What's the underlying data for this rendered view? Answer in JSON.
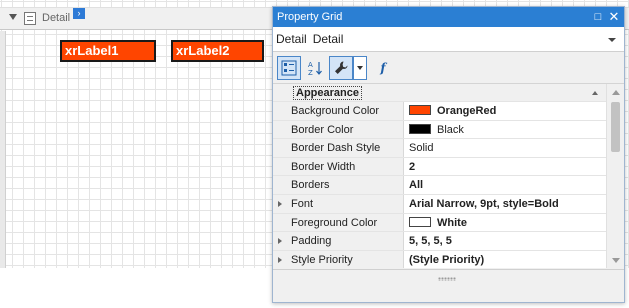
{
  "designer": {
    "band_label": "Detail",
    "labels": [
      "xrLabel1",
      "xrLabel2"
    ]
  },
  "property_grid": {
    "title": "Property Grid",
    "selected_object": {
      "name": "Detail",
      "type": "Detail"
    },
    "toolbar": {
      "categorized_icon": "categorized-icon",
      "alphabetical_icon": "sort-az-icon",
      "properties_icon": "wrench-icon",
      "events_icon": "function-icon",
      "events_glyph": "f"
    },
    "category": "Appearance",
    "rows": [
      {
        "name": "Background Color",
        "value": "OrangeRed",
        "swatch": "#ff4500",
        "bold": true,
        "expandable": false
      },
      {
        "name": "Border Color",
        "value": "Black",
        "swatch": "#000000",
        "bold": false,
        "expandable": false
      },
      {
        "name": "Border Dash Style",
        "value": "Solid",
        "bold": false,
        "expandable": false
      },
      {
        "name": "Border Width",
        "value": "2",
        "bold": true,
        "expandable": false
      },
      {
        "name": "Borders",
        "value": "All",
        "bold": true,
        "expandable": false
      },
      {
        "name": "Font",
        "value": "Arial Narrow, 9pt, style=Bold",
        "bold": true,
        "expandable": true
      },
      {
        "name": "Foreground Color",
        "value": "White",
        "swatch": "#ffffff",
        "bold": true,
        "expandable": false
      },
      {
        "name": "Padding",
        "value": "5, 5, 5, 5",
        "bold": true,
        "expandable": true
      },
      {
        "name": "Style Priority",
        "value": "(Style Priority)",
        "bold": true,
        "expandable": true
      }
    ]
  },
  "colors": {
    "accent": "#2b7fd3",
    "label_fill": "#ff4500"
  }
}
